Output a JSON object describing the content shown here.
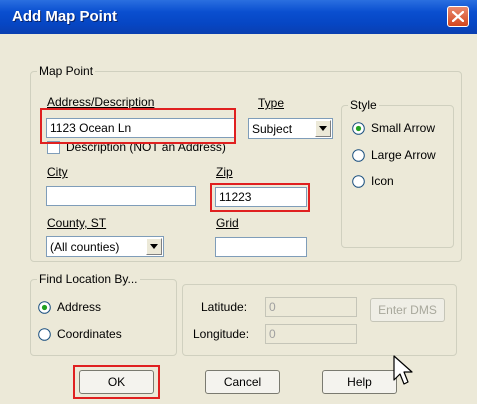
{
  "window": {
    "title": "Add Map Point"
  },
  "map_point": {
    "legend": "Map Point",
    "address_label": "Address/Description",
    "address_value": "1123 Ocean Ln",
    "type_label": "Type",
    "type_value": "Subject",
    "description_checkbox_label": "Description (NOT an Address)",
    "city_label": "City",
    "city_value": "",
    "zip_label": "Zip",
    "zip_value": "11223",
    "county_label": "County, ST",
    "county_value": "(All counties)",
    "grid_label": "Grid",
    "grid_value": "",
    "style": {
      "legend": "Style",
      "options": [
        "Small Arrow",
        "Large Arrow",
        "Icon"
      ],
      "selected": "Small Arrow"
    }
  },
  "find_location": {
    "legend": "Find Location By...",
    "options": [
      "Address",
      "Coordinates"
    ],
    "selected": "Address",
    "latitude_label": "Latitude:",
    "latitude_value": "0",
    "longitude_label": "Longitude:",
    "longitude_value": "0",
    "enter_dms_label": "Enter DMS"
  },
  "buttons": {
    "ok": "OK",
    "cancel": "Cancel",
    "help": "Help"
  },
  "colors": {
    "highlight": "#e02020",
    "titlebar": "#0a4fd0",
    "dialog_bg": "#ece9d8"
  }
}
